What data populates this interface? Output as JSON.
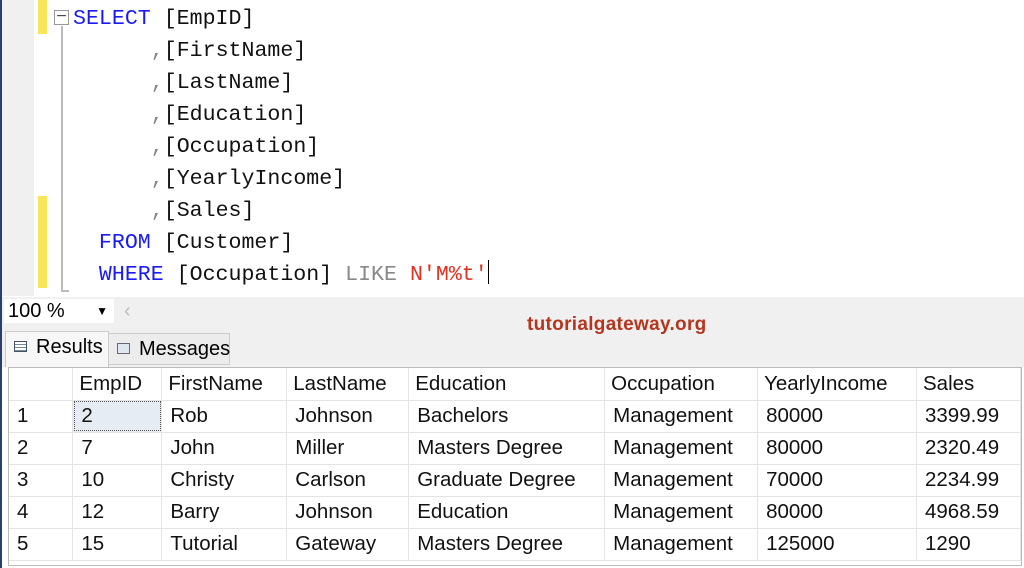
{
  "editor": {
    "lines": [
      [
        {
          "t": "SELECT",
          "c": "kw"
        },
        {
          "t": " [EmpID]"
        }
      ],
      [
        {
          "t": "      "
        },
        {
          "t": ",",
          "c": "gr"
        },
        {
          "t": "[FirstName]"
        }
      ],
      [
        {
          "t": "      "
        },
        {
          "t": ",",
          "c": "gr"
        },
        {
          "t": "[LastName]"
        }
      ],
      [
        {
          "t": "      "
        },
        {
          "t": ",",
          "c": "gr"
        },
        {
          "t": "[Education]"
        }
      ],
      [
        {
          "t": "      "
        },
        {
          "t": ",",
          "c": "gr"
        },
        {
          "t": "[Occupation]"
        }
      ],
      [
        {
          "t": "      "
        },
        {
          "t": ",",
          "c": "gr"
        },
        {
          "t": "[YearlyIncome]"
        }
      ],
      [
        {
          "t": "      "
        },
        {
          "t": ",",
          "c": "gr"
        },
        {
          "t": "[Sales]"
        }
      ],
      [
        {
          "t": "  "
        },
        {
          "t": "FROM",
          "c": "kw"
        },
        {
          "t": " [Customer]"
        }
      ],
      [
        {
          "t": "  "
        },
        {
          "t": "WHERE",
          "c": "kw"
        },
        {
          "t": " [Occupation] "
        },
        {
          "t": "LIKE",
          "c": "gr"
        },
        {
          "t": " "
        },
        {
          "t": "N'M%t'",
          "c": "st"
        }
      ]
    ]
  },
  "zoom": {
    "value": "100 %"
  },
  "watermark": "tutorialgateway.org",
  "tabs": {
    "results": "Results",
    "messages": "Messages"
  },
  "grid": {
    "columns": [
      "",
      "EmpID",
      "FirstName",
      "LastName",
      "Education",
      "Occupation",
      "YearlyIncome",
      "Sales"
    ],
    "rows": [
      [
        "1",
        "2",
        "Rob",
        "Johnson",
        "Bachelors",
        "Management",
        "80000",
        "3399.99"
      ],
      [
        "2",
        "7",
        "John",
        "Miller",
        "Masters Degree",
        "Management",
        "80000",
        "2320.49"
      ],
      [
        "3",
        "10",
        "Christy",
        "Carlson",
        "Graduate Degree",
        "Management",
        "70000",
        "2234.99"
      ],
      [
        "4",
        "12",
        "Barry",
        "Johnson",
        "Education",
        "Management",
        "80000",
        "4968.59"
      ],
      [
        "5",
        "15",
        "Tutorial",
        "Gateway",
        "Masters Degree",
        "Management",
        "125000",
        "1290"
      ]
    ]
  }
}
